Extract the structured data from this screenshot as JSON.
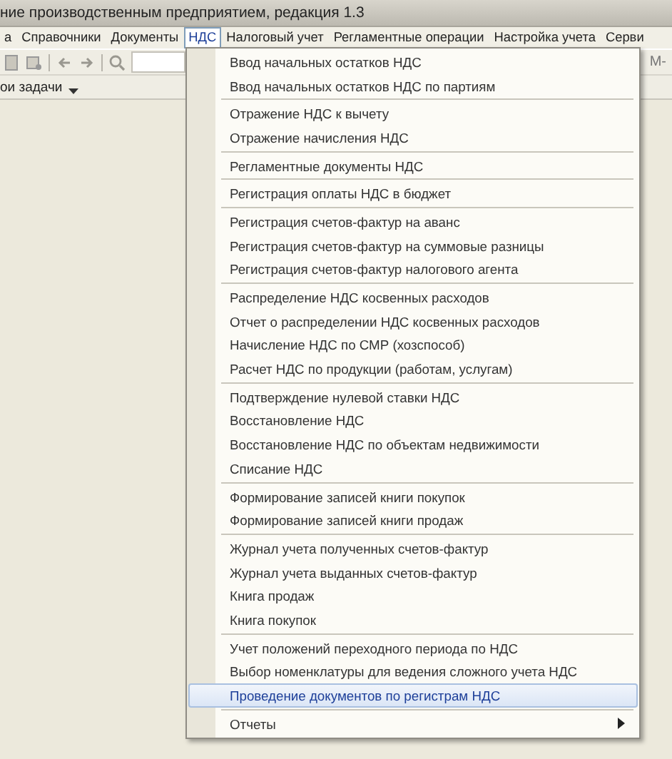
{
  "window": {
    "title": "ние производственным предприятием, редакция 1.3"
  },
  "menu_bar": [
    {
      "label": "а",
      "selected": false
    },
    {
      "label": "Справочники",
      "selected": false
    },
    {
      "label": "Документы",
      "selected": false
    },
    {
      "label": "НДС",
      "selected": true
    },
    {
      "label": "Налоговый учет",
      "selected": false
    },
    {
      "label": "Регламентные операции",
      "selected": false
    },
    {
      "label": "Настройка учета",
      "selected": false
    },
    {
      "label": "Серви",
      "selected": false
    }
  ],
  "toolbar": {
    "right_text": "М-"
  },
  "task_panel": {
    "label": "ои задачи"
  },
  "dropdown": {
    "groups": [
      [
        {
          "label": "Ввод начальных остатков НДС",
          "kind": "command",
          "selected": false
        },
        {
          "label": "Ввод начальных остатков НДС по партиям",
          "kind": "command",
          "selected": false
        }
      ],
      [
        {
          "label": "Отражение НДС к вычету",
          "kind": "command",
          "selected": false
        },
        {
          "label": "Отражение начисления НДС",
          "kind": "command",
          "selected": false
        }
      ],
      [
        {
          "label": "Регламентные документы НДС",
          "kind": "command",
          "selected": false
        }
      ],
      [
        {
          "label": "Регистрация оплаты НДС в бюджет",
          "kind": "command",
          "selected": false
        }
      ],
      [
        {
          "label": "Регистрация счетов-фактур на аванс",
          "kind": "command",
          "selected": false
        },
        {
          "label": "Регистрация счетов-фактур на суммовые разницы",
          "kind": "command",
          "selected": false
        },
        {
          "label": "Регистрация счетов-фактур налогового агента",
          "kind": "command",
          "selected": false
        }
      ],
      [
        {
          "label": "Распределение НДС косвенных расходов",
          "kind": "command",
          "selected": false
        },
        {
          "label": "Отчет о распределении НДС косвенных расходов",
          "kind": "command",
          "selected": false
        },
        {
          "label": "Начисление НДС по СМР (хозспособ)",
          "kind": "command",
          "selected": false
        },
        {
          "label": "Расчет НДС по продукции (работам, услугам)",
          "kind": "command",
          "selected": false
        }
      ],
      [
        {
          "label": "Подтверждение нулевой ставки НДС",
          "kind": "command",
          "selected": false
        },
        {
          "label": "Восстановление НДС",
          "kind": "command",
          "selected": false
        },
        {
          "label": "Восстановление НДС по объектам недвижимости",
          "kind": "command",
          "selected": false
        },
        {
          "label": "Списание НДС",
          "kind": "command",
          "selected": false
        }
      ],
      [
        {
          "label": "Формирование записей книги покупок",
          "kind": "command",
          "selected": false
        },
        {
          "label": "Формирование записей книги продаж",
          "kind": "command",
          "selected": false
        }
      ],
      [
        {
          "label": "Журнал учета полученных счетов-фактур",
          "kind": "command",
          "selected": false
        },
        {
          "label": "Журнал учета выданных счетов-фактур",
          "kind": "command",
          "selected": false
        },
        {
          "label": "Книга продаж",
          "kind": "command",
          "selected": false
        },
        {
          "label": "Книга покупок",
          "kind": "command",
          "selected": false
        }
      ],
      [
        {
          "label": "Учет положений переходного периода по НДС",
          "kind": "command",
          "selected": false
        },
        {
          "label": "Выбор номенклатуры для ведения сложного учета НДС",
          "kind": "command",
          "selected": false
        },
        {
          "label": "Проведение документов по регистрам НДС",
          "kind": "command",
          "selected": true
        }
      ],
      [
        {
          "label": "Отчеты",
          "kind": "submenu",
          "selected": false
        }
      ]
    ]
  }
}
